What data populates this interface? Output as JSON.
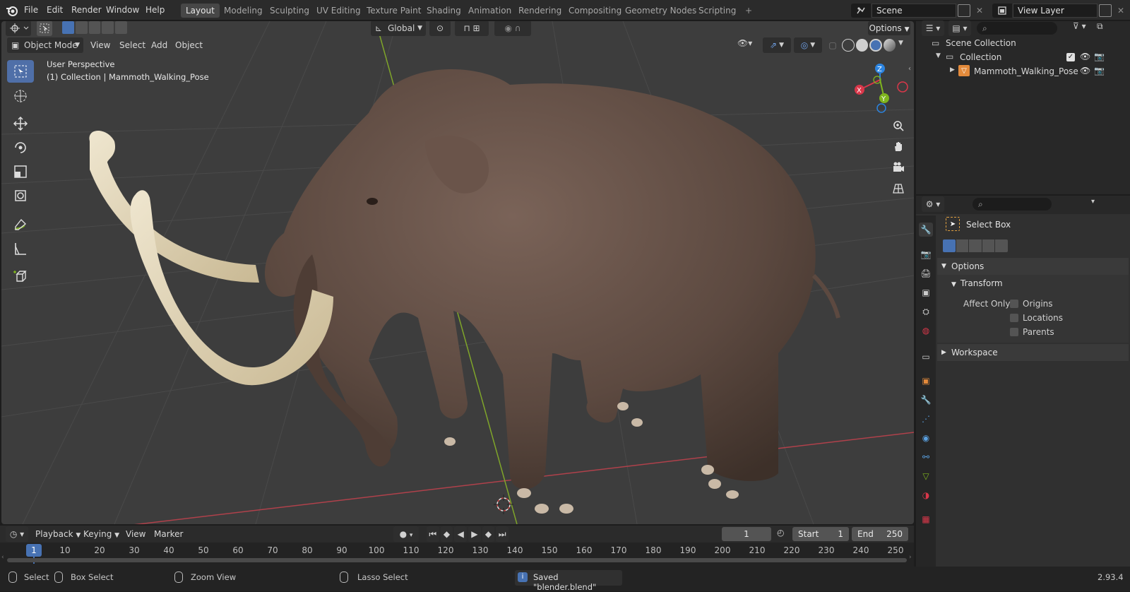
{
  "topbar": {
    "menus": [
      "File",
      "Edit",
      "Render",
      "Window",
      "Help"
    ],
    "workspaces": [
      "Layout",
      "Modeling",
      "Sculpting",
      "UV Editing",
      "Texture Paint",
      "Shading",
      "Animation",
      "Rendering",
      "Compositing",
      "Geometry Nodes",
      "Scripting"
    ],
    "add_tab": "+",
    "scene": "Scene",
    "view_layer": "View Layer"
  },
  "viewport": {
    "transform_orientation": "Global",
    "options_label": "Options",
    "mode": "Object Mode",
    "menus": [
      "View",
      "Select",
      "Add",
      "Object"
    ],
    "overlay_line1": "User Perspective",
    "overlay_line2": "(1) Collection | Mammoth_Walking_Pose",
    "gizmo": {
      "x": "X",
      "y": "Y",
      "z": "Z"
    }
  },
  "timeline": {
    "menus": [
      "Playback",
      "Keying",
      "View",
      "Marker"
    ],
    "current_frame": "1",
    "start_label": "Start",
    "start": "1",
    "end_label": "End",
    "end": "250",
    "ticks": [
      "1",
      "10",
      "20",
      "30",
      "40",
      "50",
      "60",
      "70",
      "80",
      "90",
      "100",
      "110",
      "120",
      "130",
      "140",
      "150",
      "160",
      "170",
      "180",
      "190",
      "200",
      "210",
      "220",
      "230",
      "240",
      "250"
    ]
  },
  "statusbar": {
    "select": "Select",
    "box_select": "Box Select",
    "zoom_view": "Zoom View",
    "lasso_select": "Lasso Select",
    "message": "Saved \"blender.blend\"",
    "version": "2.93.4"
  },
  "outliner": {
    "scene_collection": "Scene Collection",
    "collection": "Collection",
    "object": "Mammoth_Walking_Pose"
  },
  "properties": {
    "tool_name": "Select Box",
    "options_header": "Options",
    "transform_header": "Transform",
    "affect_only": "Affect Only",
    "origins": "Origins",
    "locations": "Locations",
    "parents": "Parents",
    "workspace_header": "Workspace"
  },
  "colors": {
    "accent": "#4772b3",
    "selected_tool": "#4f6fa8",
    "x_axis": "#d9374a",
    "y_axis": "#7fb51e",
    "z_axis": "#2c84e0",
    "viewport_bg": "#3d3d3d",
    "mammoth_skin": "#5e4a40",
    "tusk": "#dccfb0"
  }
}
